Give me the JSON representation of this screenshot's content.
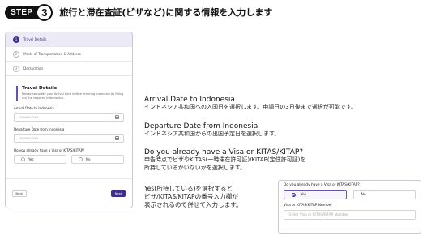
{
  "header": {
    "step_word": "STEP",
    "step_number": "3",
    "title": "旅行と滞在査証(ビザなど)に関する情報を入力します"
  },
  "form": {
    "stepper": [
      {
        "index": "1",
        "label": "Travel Details",
        "active": true
      },
      {
        "index": "2",
        "label": "Mode of Transportation & Address",
        "active": false
      },
      {
        "index": "3",
        "label": "Declaration",
        "active": false
      }
    ],
    "section_title": "Travel Details",
    "section_desc": "Please complete your Arrival Card before entering Indonesia by filling out the required information.",
    "arrival_label": "Arrival Date to Indonesia",
    "arrival_placeholder": "DD/MM/YYYY",
    "departure_label": "Departure Date from Indonesia",
    "departure_placeholder": "DD/MM/YYYY",
    "visa_question": "Do you already have a Visa or KITAS/KITAP?",
    "yes_label": "Yes",
    "no_label": "No",
    "back_label": "Back",
    "next_label": "Next"
  },
  "explanations": {
    "arrival": {
      "title": "Arrival Date to Indonesia",
      "desc": "インドネシア共和国への入国日を選択します。申請日の3日後まで選択が可能です。"
    },
    "departure": {
      "title": "Departure Date from Indonesia",
      "desc": "インドネシア共和国からの出国予定日を選択します。"
    },
    "visa": {
      "title": "Do you already have a Visa or KITAS/KITAP?",
      "desc_line1": "申告時点でビザやKITAS(一時滞在許可証)/KITAP(定住許可証)を",
      "desc_line2": "所持しているかいないかを選択します。"
    },
    "yes_note": {
      "line1": "Yes(所持している)を選択すると",
      "line2": "ビザ/KITAS/KITAPの番号入力欄が",
      "line3": "表示されるので併せて入力します。"
    }
  },
  "zoom": {
    "question": "Do you already have a Visa or KITAS/KITAP?",
    "yes_label": "Yes",
    "no_label": "No",
    "number_label": "Visa or KITAS/KITAP Number",
    "number_placeholder": "Enter Visa or KITAS/KITAP Number"
  }
}
